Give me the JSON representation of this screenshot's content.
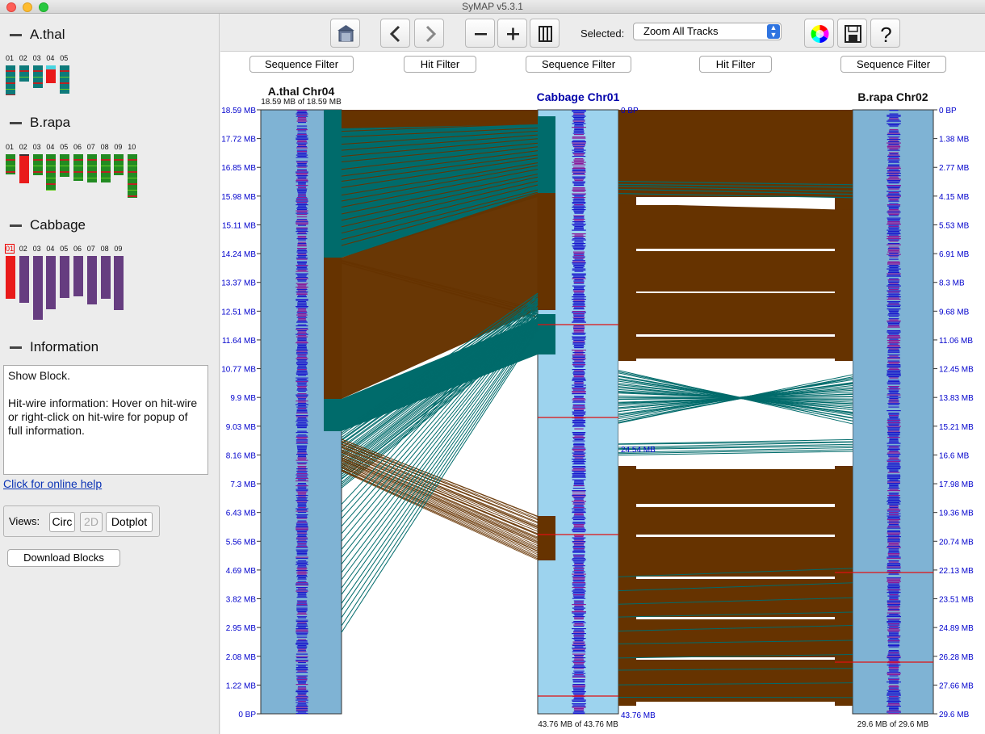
{
  "window": {
    "title": "SyMAP v5.3.1"
  },
  "left": {
    "sections": {
      "athal": "A.thal",
      "brapa": "B.rapa",
      "cabbage": "Cabbage",
      "information": "Information"
    },
    "athal_chrs": [
      "01",
      "02",
      "03",
      "04",
      "05"
    ],
    "brapa_chrs": [
      "01",
      "02",
      "03",
      "04",
      "05",
      "06",
      "07",
      "08",
      "09",
      "10"
    ],
    "cabbage_chrs": [
      "01",
      "02",
      "03",
      "04",
      "05",
      "06",
      "07",
      "08",
      "09"
    ],
    "info_text": "Show Block.\n\nHit-wire information: Hover on hit-wire or right-click on hit-wire for popup of full information.",
    "help_link": "Click for online help",
    "views_label": "Views:",
    "views": [
      "Circ",
      "2D",
      "Dotplot"
    ],
    "download_label": "Download Blocks"
  },
  "toolbar": {
    "selected_label": "Selected:",
    "selected_value": "Zoom All Tracks",
    "icons": [
      "home-icon",
      "back-icon",
      "forward-icon",
      "zoom-out-icon",
      "zoom-in-icon",
      "fit-icon",
      "color-wheel-icon",
      "save-icon",
      "help-icon"
    ]
  },
  "filters": [
    "Sequence Filter",
    "Hit Filter",
    "Sequence Filter",
    "Hit Filter",
    "Sequence Filter"
  ],
  "tracks": {
    "left": {
      "title": "A.thal Chr04",
      "subtitle": "18.59 MB of 18.59 MB",
      "ticks": [
        "18.59 MB",
        "17.72 MB",
        "16.85 MB",
        "15.98 MB",
        "15.11 MB",
        "14.24 MB",
        "13.37 MB",
        "12.51 MB",
        "11.64 MB",
        "10.77 MB",
        "9.9 MB",
        "9.03 MB",
        "8.16 MB",
        "7.3 MB",
        "6.43 MB",
        "5.56 MB",
        "4.69 MB",
        "3.82 MB",
        "2.95 MB",
        "2.08 MB",
        "1.22 MB",
        "0 BP"
      ]
    },
    "middle": {
      "title": "Cabbage Chr01",
      "footer": "43.76 MB of 43.76 MB",
      "ticks": [
        "0 BP",
        "24.54 MB",
        "43.76 MB"
      ]
    },
    "right": {
      "title": "B.rapa Chr02",
      "footer": "29.6 MB of 29.6 MB",
      "ticks": [
        "0 BP",
        "1.38 MB",
        "2.77 MB",
        "4.15 MB",
        "5.53 MB",
        "6.91 MB",
        "8.3 MB",
        "9.68 MB",
        "11.06 MB",
        "12.45 MB",
        "13.83 MB",
        "15.21 MB",
        "16.6 MB",
        "17.98 MB",
        "19.36 MB",
        "20.74 MB",
        "22.13 MB",
        "23.51 MB",
        "24.89 MB",
        "26.28 MB",
        "27.66 MB",
        "29.6 MB"
      ]
    }
  },
  "colors": {
    "track": "#7fb3d4",
    "track_middle": "#9dd3ee",
    "teal": "#006b6b",
    "brown": "#663300",
    "tick_text": "#0000cc",
    "title_blue": "#0000aa"
  }
}
